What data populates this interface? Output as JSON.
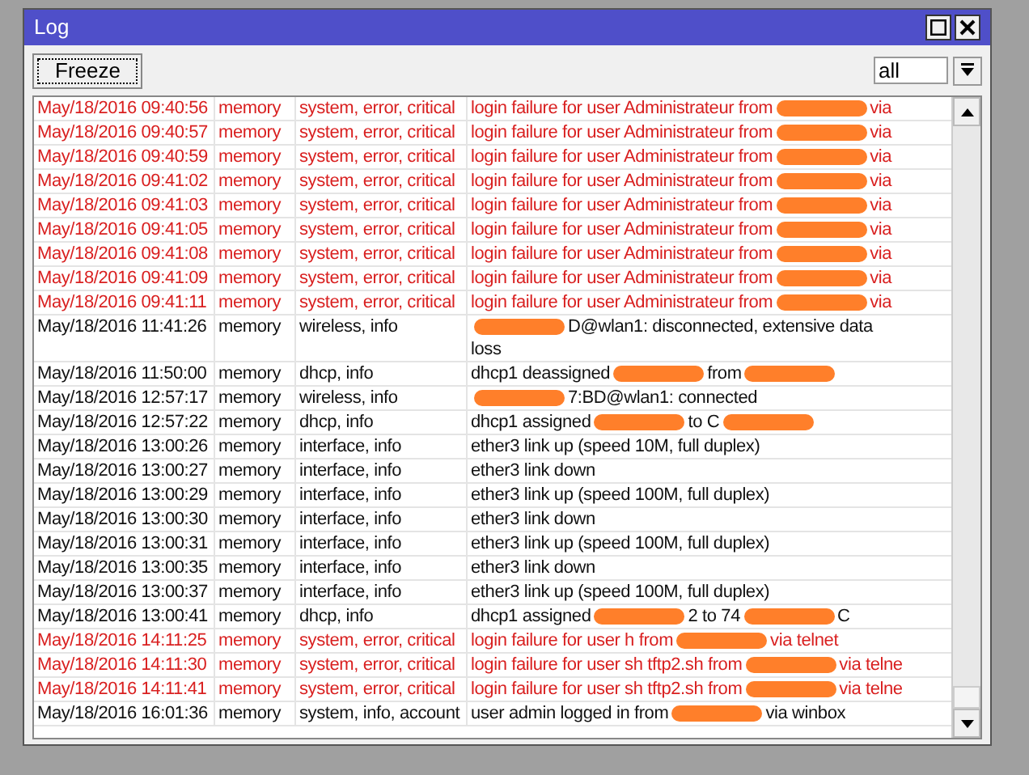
{
  "window": {
    "title": "Log"
  },
  "toolbar": {
    "freeze_button": "Freeze",
    "filter": {
      "value": "all"
    }
  },
  "rows": [
    {
      "time": "May/18/2016 09:40:56",
      "buffer": "memory",
      "topics": "system, error, critical",
      "error": true,
      "message": [
        {
          "kind": "text",
          "text": "login failure for user Administrateur from"
        },
        {
          "kind": "redaction"
        },
        {
          "kind": "text",
          "text": "via"
        }
      ]
    },
    {
      "time": "May/18/2016 09:40:57",
      "buffer": "memory",
      "topics": "system, error, critical",
      "error": true,
      "message": [
        {
          "kind": "text",
          "text": "login failure for user Administrateur from"
        },
        {
          "kind": "redaction"
        },
        {
          "kind": "text",
          "text": "via"
        }
      ]
    },
    {
      "time": "May/18/2016 09:40:59",
      "buffer": "memory",
      "topics": "system, error, critical",
      "error": true,
      "message": [
        {
          "kind": "text",
          "text": "login failure for user Administrateur from"
        },
        {
          "kind": "redaction"
        },
        {
          "kind": "text",
          "text": "via"
        }
      ]
    },
    {
      "time": "May/18/2016 09:41:02",
      "buffer": "memory",
      "topics": "system, error, critical",
      "error": true,
      "message": [
        {
          "kind": "text",
          "text": "login failure for user Administrateur from"
        },
        {
          "kind": "redaction"
        },
        {
          "kind": "text",
          "text": "via"
        }
      ]
    },
    {
      "time": "May/18/2016 09:41:03",
      "buffer": "memory",
      "topics": "system, error, critical",
      "error": true,
      "message": [
        {
          "kind": "text",
          "text": "login failure for user Administrateur from"
        },
        {
          "kind": "redaction"
        },
        {
          "kind": "text",
          "text": "via"
        }
      ]
    },
    {
      "time": "May/18/2016 09:41:05",
      "buffer": "memory",
      "topics": "system, error, critical",
      "error": true,
      "message": [
        {
          "kind": "text",
          "text": "login failure for user Administrateur from"
        },
        {
          "kind": "redaction"
        },
        {
          "kind": "text",
          "text": "via"
        }
      ]
    },
    {
      "time": "May/18/2016 09:41:08",
      "buffer": "memory",
      "topics": "system, error, critical",
      "error": true,
      "message": [
        {
          "kind": "text",
          "text": "login failure for user Administrateur from"
        },
        {
          "kind": "redaction"
        },
        {
          "kind": "text",
          "text": "via"
        }
      ]
    },
    {
      "time": "May/18/2016 09:41:09",
      "buffer": "memory",
      "topics": "system, error, critical",
      "error": true,
      "message": [
        {
          "kind": "text",
          "text": "login failure for user Administrateur from"
        },
        {
          "kind": "redaction"
        },
        {
          "kind": "text",
          "text": "via"
        }
      ]
    },
    {
      "time": "May/18/2016 09:41:11",
      "buffer": "memory",
      "topics": "system, error, critical",
      "error": true,
      "message": [
        {
          "kind": "text",
          "text": "login failure for user Administrateur from"
        },
        {
          "kind": "redaction"
        },
        {
          "kind": "text",
          "text": "via"
        }
      ]
    },
    {
      "time": "May/18/2016 11:41:26",
      "buffer": "memory",
      "topics": "wireless, info",
      "error": false,
      "message": [
        {
          "kind": "redaction"
        },
        {
          "kind": "text",
          "text": "D@wlan1: disconnected, extensive data"
        },
        {
          "kind": "break"
        },
        {
          "kind": "text",
          "text": "loss"
        }
      ]
    },
    {
      "time": "May/18/2016 11:50:00",
      "buffer": "memory",
      "topics": "dhcp, info",
      "error": false,
      "message": [
        {
          "kind": "text",
          "text": "dhcp1 deassigned"
        },
        {
          "kind": "redaction"
        },
        {
          "kind": "text",
          "text": "from"
        },
        {
          "kind": "redaction"
        }
      ]
    },
    {
      "time": "May/18/2016 12:57:17",
      "buffer": "memory",
      "topics": "wireless, info",
      "error": false,
      "message": [
        {
          "kind": "redaction"
        },
        {
          "kind": "text",
          "text": "7:BD@wlan1: connected"
        }
      ]
    },
    {
      "time": "May/18/2016 12:57:22",
      "buffer": "memory",
      "topics": "dhcp, info",
      "error": false,
      "message": [
        {
          "kind": "text",
          "text": "dhcp1 assigned"
        },
        {
          "kind": "redaction"
        },
        {
          "kind": "text",
          "text": "to C"
        },
        {
          "kind": "redaction"
        }
      ]
    },
    {
      "time": "May/18/2016 13:00:26",
      "buffer": "memory",
      "topics": "interface, info",
      "error": false,
      "message": [
        {
          "kind": "text",
          "text": "ether3 link up (speed 10M, full duplex)"
        }
      ]
    },
    {
      "time": "May/18/2016 13:00:27",
      "buffer": "memory",
      "topics": "interface, info",
      "error": false,
      "message": [
        {
          "kind": "text",
          "text": "ether3 link down"
        }
      ]
    },
    {
      "time": "May/18/2016 13:00:29",
      "buffer": "memory",
      "topics": "interface, info",
      "error": false,
      "message": [
        {
          "kind": "text",
          "text": "ether3 link up (speed 100M, full duplex)"
        }
      ]
    },
    {
      "time": "May/18/2016 13:00:30",
      "buffer": "memory",
      "topics": "interface, info",
      "error": false,
      "message": [
        {
          "kind": "text",
          "text": "ether3 link down"
        }
      ]
    },
    {
      "time": "May/18/2016 13:00:31",
      "buffer": "memory",
      "topics": "interface, info",
      "error": false,
      "message": [
        {
          "kind": "text",
          "text": "ether3 link up (speed 100M, full duplex)"
        }
      ]
    },
    {
      "time": "May/18/2016 13:00:35",
      "buffer": "memory",
      "topics": "interface, info",
      "error": false,
      "message": [
        {
          "kind": "text",
          "text": "ether3 link down"
        }
      ]
    },
    {
      "time": "May/18/2016 13:00:37",
      "buffer": "memory",
      "topics": "interface, info",
      "error": false,
      "message": [
        {
          "kind": "text",
          "text": "ether3 link up (speed 100M, full duplex)"
        }
      ]
    },
    {
      "time": "May/18/2016 13:00:41",
      "buffer": "memory",
      "topics": "dhcp, info",
      "error": false,
      "message": [
        {
          "kind": "text",
          "text": "dhcp1 assigned"
        },
        {
          "kind": "redaction"
        },
        {
          "kind": "text",
          "text": "2 to 74"
        },
        {
          "kind": "redaction"
        },
        {
          "kind": "text",
          "text": "C"
        }
      ]
    },
    {
      "time": "May/18/2016 14:11:25",
      "buffer": "memory",
      "topics": "system, error, critical",
      "error": true,
      "message": [
        {
          "kind": "text",
          "text": "login failure for user h from"
        },
        {
          "kind": "redaction"
        },
        {
          "kind": "text",
          "text": "via telnet"
        }
      ]
    },
    {
      "time": "May/18/2016 14:11:30",
      "buffer": "memory",
      "topics": "system, error, critical",
      "error": true,
      "message": [
        {
          "kind": "text",
          "text": "login failure for user sh tftp2.sh from"
        },
        {
          "kind": "redaction"
        },
        {
          "kind": "text",
          "text": "via telne"
        }
      ]
    },
    {
      "time": "May/18/2016 14:11:41",
      "buffer": "memory",
      "topics": "system, error, critical",
      "error": true,
      "message": [
        {
          "kind": "text",
          "text": "login failure for user sh tftp2.sh from"
        },
        {
          "kind": "redaction"
        },
        {
          "kind": "text",
          "text": "via telne"
        }
      ]
    },
    {
      "time": "May/18/2016 16:01:36",
      "buffer": "memory",
      "topics": "system, info, account",
      "error": false,
      "message": [
        {
          "kind": "text",
          "text": "user admin logged in from"
        },
        {
          "kind": "redaction"
        },
        {
          "kind": "text",
          "text": "via winbox"
        }
      ]
    }
  ]
}
